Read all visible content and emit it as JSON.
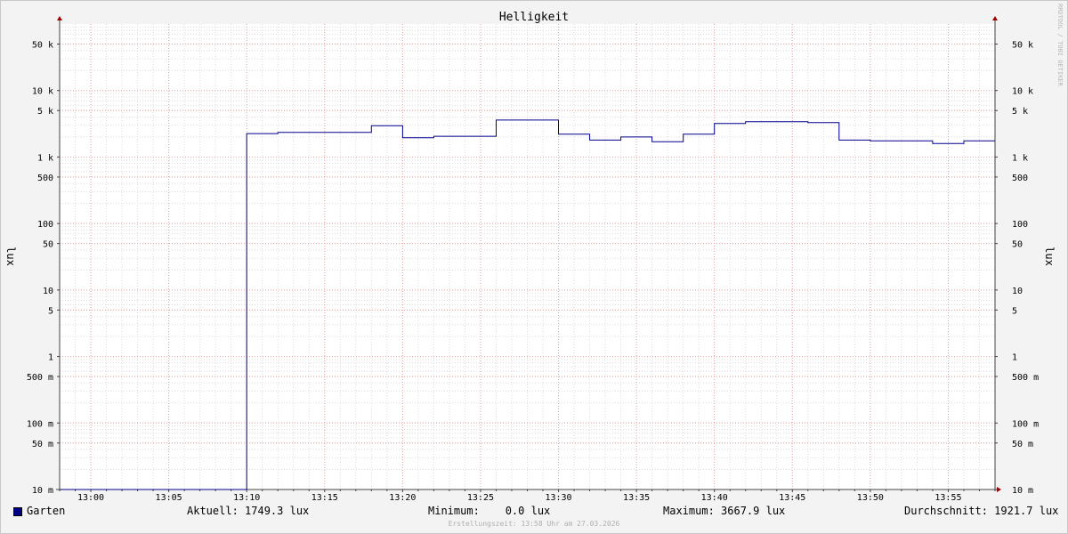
{
  "chart_data": {
    "type": "line",
    "title": "Helligkeit",
    "ylabel": "lux",
    "ylabel_right": "lux",
    "y_scale": "log",
    "ylim": [
      0.01,
      100000
    ],
    "xlim": [
      "12:58",
      "13:58"
    ],
    "x_ticks": [
      "13:00",
      "13:05",
      "13:10",
      "13:15",
      "13:20",
      "13:25",
      "13:30",
      "13:35",
      "13:40",
      "13:45",
      "13:50",
      "13:55"
    ],
    "y_ticks": [
      {
        "value": 50000,
        "label": "50 k"
      },
      {
        "value": 10000,
        "label": "10 k"
      },
      {
        "value": 5000,
        "label": "5 k"
      },
      {
        "value": 1000,
        "label": "1 k"
      },
      {
        "value": 500,
        "label": "500"
      },
      {
        "value": 100,
        "label": "100"
      },
      {
        "value": 50,
        "label": "50"
      },
      {
        "value": 10,
        "label": "10"
      },
      {
        "value": 5,
        "label": "5"
      },
      {
        "value": 1,
        "label": "1"
      },
      {
        "value": 0.5,
        "label": "500 m"
      },
      {
        "value": 0.1,
        "label": "100 m"
      },
      {
        "value": 0.05,
        "label": "50 m"
      },
      {
        "value": 0.01,
        "label": "10 m"
      }
    ],
    "grid": true,
    "series": [
      {
        "name": "Garten",
        "color": "#00008b",
        "points": [
          [
            "12:58",
            0.0
          ],
          [
            "13:10",
            0.0
          ],
          [
            "13:10",
            2250
          ],
          [
            "13:12",
            2250
          ],
          [
            "13:12",
            2350
          ],
          [
            "13:18",
            2350
          ],
          [
            "13:18",
            2950
          ],
          [
            "13:20",
            2950
          ],
          [
            "13:20",
            1950
          ],
          [
            "13:22",
            1950
          ],
          [
            "13:22",
            2050
          ],
          [
            "13:26",
            2050
          ],
          [
            "13:26",
            3600
          ],
          [
            "13:30",
            3600
          ],
          [
            "13:30",
            2200
          ],
          [
            "13:32",
            2200
          ],
          [
            "13:32",
            1800
          ],
          [
            "13:34",
            1800
          ],
          [
            "13:34",
            2000
          ],
          [
            "13:36",
            2000
          ],
          [
            "13:36",
            1700
          ],
          [
            "13:38",
            1700
          ],
          [
            "13:38",
            2200
          ],
          [
            "13:40",
            2200
          ],
          [
            "13:40",
            3200
          ],
          [
            "13:42",
            3200
          ],
          [
            "13:42",
            3400
          ],
          [
            "13:46",
            3400
          ],
          [
            "13:46",
            3300
          ],
          [
            "13:48",
            3300
          ],
          [
            "13:48",
            1800
          ],
          [
            "13:50",
            1800
          ],
          [
            "13:50",
            1750
          ],
          [
            "13:54",
            1750
          ],
          [
            "13:54",
            1600
          ],
          [
            "13:56",
            1600
          ],
          [
            "13:56",
            1749.3
          ],
          [
            "13:58",
            1749.3
          ]
        ]
      }
    ]
  },
  "legend": {
    "series_name": "Garten",
    "current": "Aktuell: 1749.3 lux",
    "minimum": "Minimum:    0.0 lux",
    "maximum": "Maximum: 3667.9 lux",
    "average": "Durchschnitt: 1921.7 lux"
  },
  "footer": "Erstellungszeit: 13:58 Uhr am 27.03.2026",
  "watermark": "RRDTOOL / TOBI OETIKER"
}
